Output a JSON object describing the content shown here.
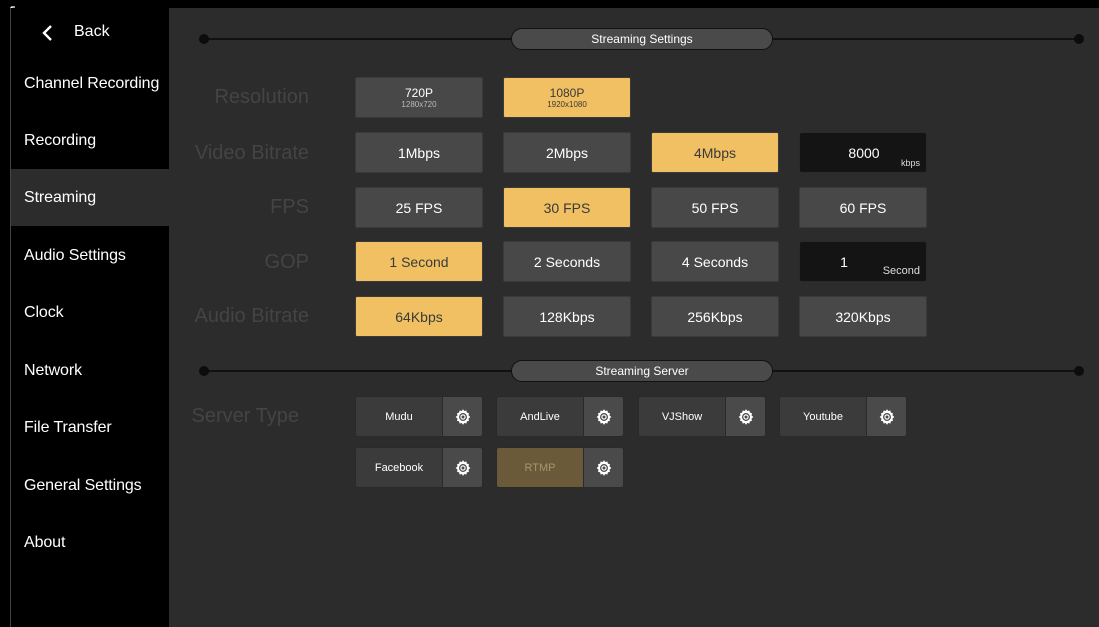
{
  "sidebar": {
    "back_label": "Back",
    "items": [
      {
        "label": "Channel Recording",
        "active": false
      },
      {
        "label": "Recording",
        "active": false
      },
      {
        "label": "Streaming",
        "active": true
      },
      {
        "label": "Audio Settings",
        "active": false
      },
      {
        "label": "Clock",
        "active": false
      },
      {
        "label": "Network",
        "active": false
      },
      {
        "label": "File Transfer",
        "active": false
      },
      {
        "label": "General Settings",
        "active": false
      },
      {
        "label": "About",
        "active": false
      }
    ]
  },
  "streaming_settings": {
    "title": "Streaming Settings",
    "resolution": {
      "label": "Resolution",
      "options": [
        {
          "label": "720P",
          "sub": "1280x720",
          "selected": false
        },
        {
          "label": "1080P",
          "sub": "1920x1080",
          "selected": true
        }
      ]
    },
    "video_bitrate": {
      "label": "Video Bitrate",
      "options": [
        {
          "label": "1Mbps",
          "selected": false
        },
        {
          "label": "2Mbps",
          "selected": false
        },
        {
          "label": "4Mbps",
          "selected": true
        }
      ],
      "custom_value": "8000",
      "custom_unit": "kbps"
    },
    "fps": {
      "label": "FPS",
      "options": [
        {
          "label": "25 FPS",
          "selected": false
        },
        {
          "label": "30 FPS",
          "selected": true
        },
        {
          "label": "50 FPS",
          "selected": false
        },
        {
          "label": "60 FPS",
          "selected": false
        }
      ]
    },
    "gop": {
      "label": "GOP",
      "options": [
        {
          "label": "1 Second",
          "selected": true
        },
        {
          "label": "2 Seconds",
          "selected": false
        },
        {
          "label": "4 Seconds",
          "selected": false
        }
      ],
      "custom_value": "1",
      "custom_unit": "Second"
    },
    "audio_bitrate": {
      "label": "Audio Bitrate",
      "options": [
        {
          "label": "64Kbps",
          "selected": true
        },
        {
          "label": "128Kbps",
          "selected": false
        },
        {
          "label": "256Kbps",
          "selected": false
        },
        {
          "label": "320Kbps",
          "selected": false
        }
      ]
    }
  },
  "streaming_server": {
    "title": "Streaming Server",
    "server_type_label": "Server Type",
    "servers": [
      {
        "name": "Mudu",
        "active": false
      },
      {
        "name": "AndLive",
        "active": false
      },
      {
        "name": "VJShow",
        "active": false
      },
      {
        "name": "Youtube",
        "active": false
      },
      {
        "name": "Facebook",
        "active": false
      },
      {
        "name": "RTMP",
        "active": true
      }
    ]
  },
  "colors": {
    "accent": "#f0c062",
    "panel": "#2c2c2c",
    "sidebar": "#000000",
    "button": "#484848",
    "active_server": "#6b5a3a"
  },
  "icons": {
    "back": "chevron-left-icon",
    "settings": "gear-icon"
  }
}
